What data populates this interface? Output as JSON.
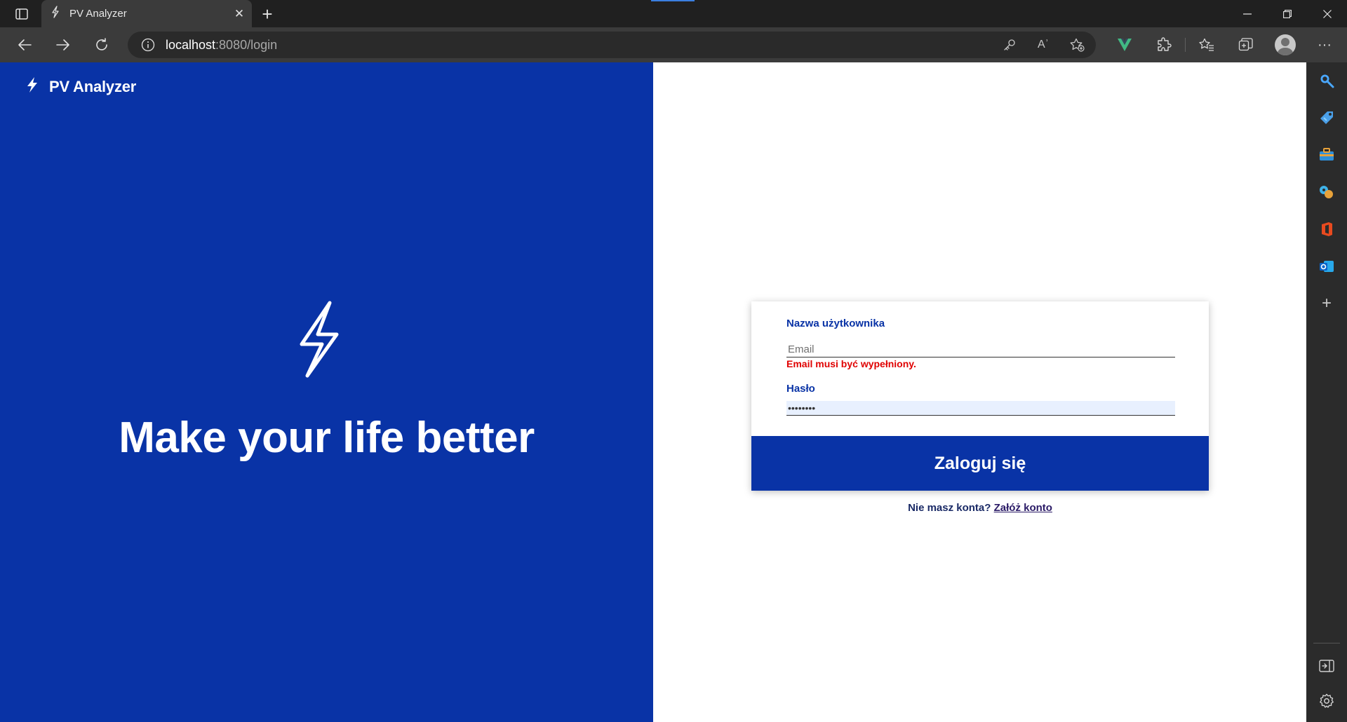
{
  "browser": {
    "tab_title": "PV Analyzer",
    "url_host": "localhost",
    "url_rest": ":8080/login",
    "tab_close": "✕",
    "new_tab": "+",
    "window": {
      "minimize": "—",
      "maximize": "❐",
      "close": "✕"
    },
    "address_icons": [
      "key-icon",
      "read-aloud-icon",
      "add-favorite-icon"
    ],
    "toolbar_icons": [
      "vue-devtools-icon",
      "extensions-icon",
      "favorites-icon",
      "collections-icon",
      "profile-icon",
      "more-icon"
    ],
    "read_aloud_glyph": "Aʾ",
    "more_glyph": "···"
  },
  "sidebar": {
    "icons": [
      "search-icon",
      "shopping-icon",
      "tools-icon",
      "games-icon",
      "office-icon",
      "outlook-icon",
      "add-icon"
    ],
    "add_glyph": "+"
  },
  "app": {
    "brand": "PV Analyzer",
    "tagline": "Make your life better",
    "form": {
      "username_label": "Nazwa użytkownika",
      "email_placeholder": "Email",
      "email_value": "",
      "email_error": "Email musi być wypełniony.",
      "password_label": "Hasło",
      "password_value": "••••••••",
      "submit_label": "Zaloguj się",
      "no_account_text": "Nie masz konta?",
      "signup_link": "Załóż konto"
    }
  },
  "colors": {
    "brand_blue": "#0933a6",
    "error_red": "#e00000",
    "chrome_dark": "#202020",
    "vue_green": "#41b883"
  }
}
